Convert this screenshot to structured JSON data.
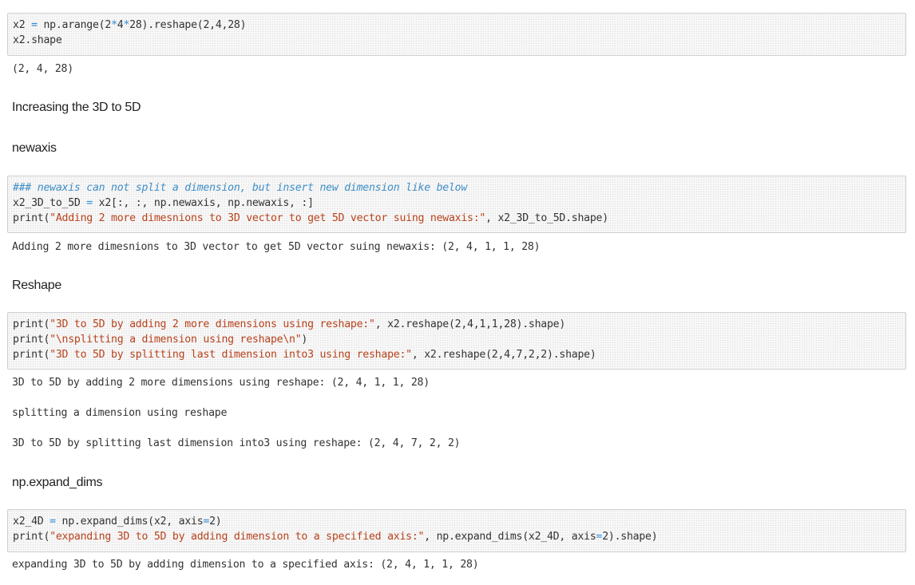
{
  "cells": {
    "cell1": {
      "code": [
        [
          {
            "t": "x2 ",
            "k": "plain"
          },
          {
            "t": "=",
            "k": "op"
          },
          {
            "t": " np.arange(2",
            "k": "plain"
          },
          {
            "t": "*",
            "k": "op"
          },
          {
            "t": "4",
            "k": "plain"
          },
          {
            "t": "*",
            "k": "op"
          },
          {
            "t": "28).reshape(2,4,28)",
            "k": "plain"
          }
        ],
        [
          {
            "t": "x2.shape",
            "k": "plain"
          }
        ]
      ],
      "output": [
        "(2, 4, 28)"
      ]
    },
    "md1": "Increasing the 3D to 5D",
    "md2": "newaxis",
    "cell2": {
      "code": [
        [
          {
            "t": "### newaxis can not split a dimension, but insert new dimension like below",
            "k": "comment"
          }
        ],
        [
          {
            "t": "x2_3D_to_5D ",
            "k": "plain"
          },
          {
            "t": "=",
            "k": "op"
          },
          {
            "t": " x2[:, :, np.newaxis, np.newaxis, :]",
            "k": "plain"
          }
        ],
        [
          {
            "t": "print(",
            "k": "plain"
          },
          {
            "t": "\"Adding 2 more dimesnions to 3D vector to get 5D vector suing newaxis:\"",
            "k": "str"
          },
          {
            "t": ", x2_3D_to_5D.shape)",
            "k": "plain"
          }
        ]
      ],
      "output": [
        "Adding 2 more dimesnions to 3D vector to get 5D vector suing newaxis: (2, 4, 1, 1, 28)"
      ]
    },
    "md3": "Reshape",
    "cell3": {
      "code": [
        [
          {
            "t": "print(",
            "k": "plain"
          },
          {
            "t": "\"3D to 5D by adding 2 more dimensions using reshape:\"",
            "k": "str"
          },
          {
            "t": ", x2.reshape(2,4,1,1,28).shape)",
            "k": "plain"
          }
        ],
        [
          {
            "t": "print(",
            "k": "plain"
          },
          {
            "t": "\"\\nsplitting a dimension using reshape\\n\"",
            "k": "str"
          },
          {
            "t": ")",
            "k": "plain"
          }
        ],
        [
          {
            "t": "print(",
            "k": "plain"
          },
          {
            "t": "\"3D to 5D by splitting last dimension into3 using reshape:\"",
            "k": "str"
          },
          {
            "t": ", x2.reshape(2,4,7,2,2).shape)",
            "k": "plain"
          }
        ]
      ],
      "output": [
        "3D to 5D by adding 2 more dimensions using reshape: (2, 4, 1, 1, 28)",
        "splitting a dimension using reshape",
        "3D to 5D by splitting last dimension into3 using reshape: (2, 4, 7, 2, 2)"
      ]
    },
    "md4": "np.expand_dims",
    "cell4": {
      "code": [
        [
          {
            "t": "x2_4D ",
            "k": "plain"
          },
          {
            "t": "=",
            "k": "op"
          },
          {
            "t": " np.expand_dims(x2, axis",
            "k": "plain"
          },
          {
            "t": "=",
            "k": "op"
          },
          {
            "t": "2)",
            "k": "plain"
          }
        ],
        [
          {
            "t": "print(",
            "k": "plain"
          },
          {
            "t": "\"expanding 3D to 5D by adding dimension to a specified axis:\"",
            "k": "str"
          },
          {
            "t": ", np.expand_dims(x2_4D, axis",
            "k": "plain"
          },
          {
            "t": "=",
            "k": "op"
          },
          {
            "t": "2).shape)",
            "k": "plain"
          }
        ]
      ],
      "output": [
        "expanding 3D to 5D by adding dimension to a specified axis: (2, 4, 1, 1, 28)"
      ]
    }
  }
}
